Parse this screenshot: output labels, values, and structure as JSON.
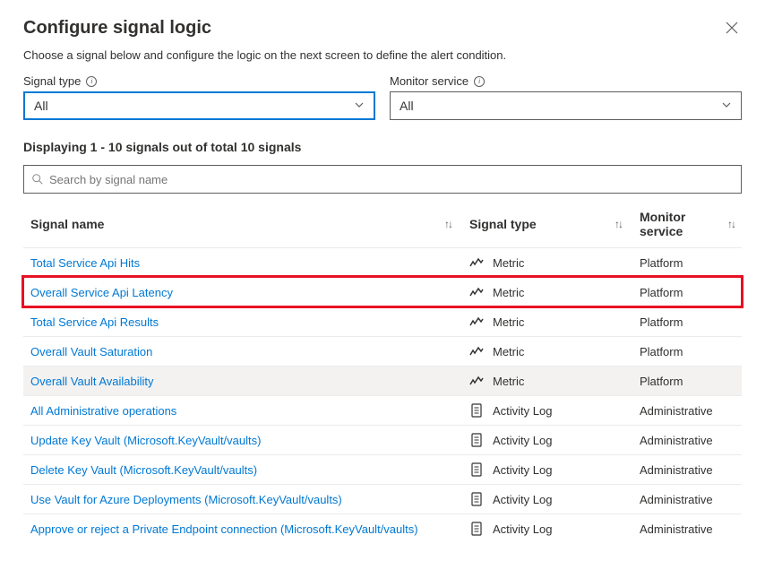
{
  "header": {
    "title": "Configure signal logic",
    "description": "Choose a signal below and configure the logic on the next screen to define the alert condition."
  },
  "filters": {
    "signal_type": {
      "label": "Signal type",
      "value": "All"
    },
    "monitor_service": {
      "label": "Monitor service",
      "value": "All"
    }
  },
  "count_text": "Displaying 1 - 10 signals out of total 10 signals",
  "search": {
    "placeholder": "Search by signal name"
  },
  "columns": {
    "name": "Signal name",
    "type": "Signal type",
    "service": "Monitor service"
  },
  "rows": [
    {
      "name": "Total Service Api Hits",
      "type": "Metric",
      "service": "Platform",
      "icon": "metric",
      "highlight": false,
      "hover": false
    },
    {
      "name": "Overall Service Api Latency",
      "type": "Metric",
      "service": "Platform",
      "icon": "metric",
      "highlight": true,
      "hover": false
    },
    {
      "name": "Total Service Api Results",
      "type": "Metric",
      "service": "Platform",
      "icon": "metric",
      "highlight": false,
      "hover": false
    },
    {
      "name": "Overall Vault Saturation",
      "type": "Metric",
      "service": "Platform",
      "icon": "metric",
      "highlight": false,
      "hover": false
    },
    {
      "name": "Overall Vault Availability",
      "type": "Metric",
      "service": "Platform",
      "icon": "metric",
      "highlight": false,
      "hover": true
    },
    {
      "name": "All Administrative operations",
      "type": "Activity Log",
      "service": "Administrative",
      "icon": "log",
      "highlight": false,
      "hover": false
    },
    {
      "name": "Update Key Vault (Microsoft.KeyVault/vaults)",
      "type": "Activity Log",
      "service": "Administrative",
      "icon": "log",
      "highlight": false,
      "hover": false
    },
    {
      "name": "Delete Key Vault (Microsoft.KeyVault/vaults)",
      "type": "Activity Log",
      "service": "Administrative",
      "icon": "log",
      "highlight": false,
      "hover": false
    },
    {
      "name": "Use Vault for Azure Deployments (Microsoft.KeyVault/vaults)",
      "type": "Activity Log",
      "service": "Administrative",
      "icon": "log",
      "highlight": false,
      "hover": false
    },
    {
      "name": "Approve or reject a Private Endpoint connection (Microsoft.KeyVault/vaults)",
      "type": "Activity Log",
      "service": "Administrative",
      "icon": "log",
      "highlight": false,
      "hover": false
    }
  ]
}
